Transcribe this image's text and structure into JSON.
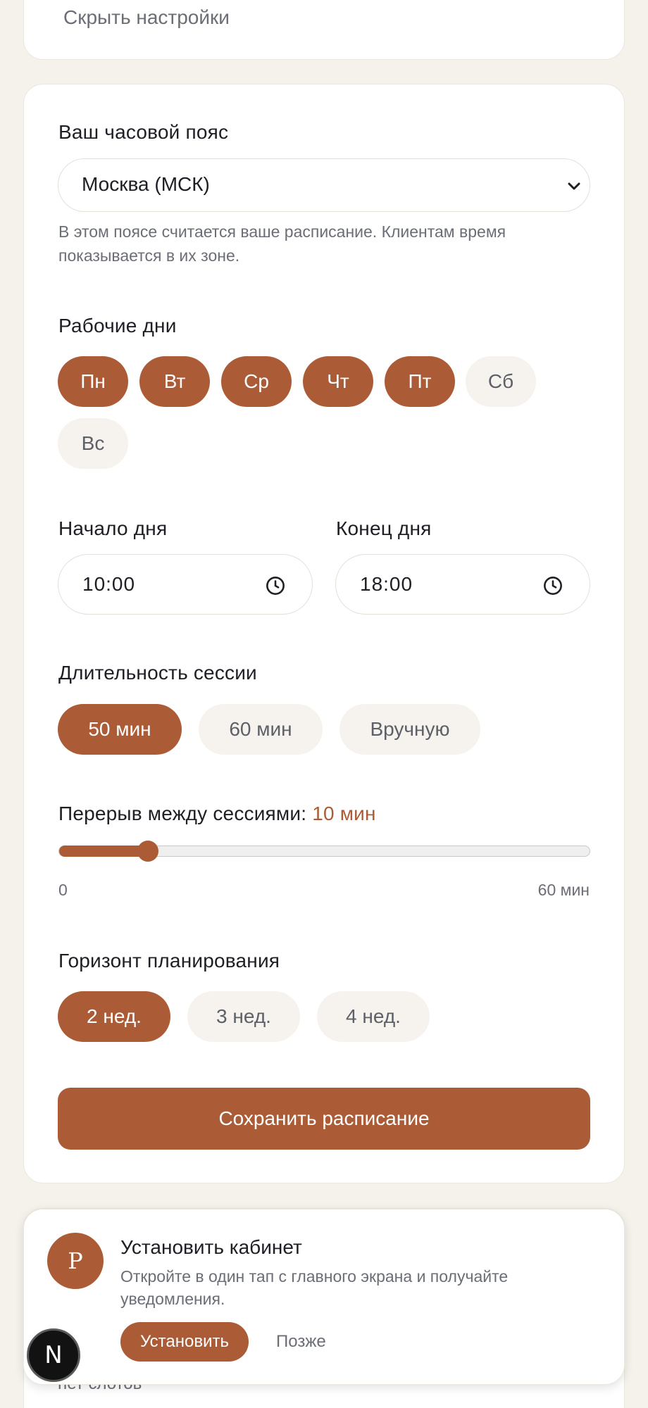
{
  "settings_header": {
    "hide_link": "Скрыть настройки"
  },
  "timezone": {
    "label": "Ваш часовой пояс",
    "value": "Москва (МСК)",
    "help": "В этом поясе считается ваше расписание. Клиентам время показывается в их зоне."
  },
  "workdays": {
    "label": "Рабочие дни",
    "days": [
      {
        "label": "Пн",
        "selected": true
      },
      {
        "label": "Вт",
        "selected": true
      },
      {
        "label": "Ср",
        "selected": true
      },
      {
        "label": "Чт",
        "selected": true
      },
      {
        "label": "Пт",
        "selected": true
      },
      {
        "label": "Сб",
        "selected": false
      },
      {
        "label": "Вс",
        "selected": false
      }
    ]
  },
  "hours": {
    "start_label": "Начало дня",
    "start_value": "10:00",
    "end_label": "Конец дня",
    "end_value": "18:00"
  },
  "session": {
    "label": "Длительность сессии",
    "options": [
      {
        "label": "50 мин",
        "selected": true
      },
      {
        "label": "60 мин",
        "selected": false
      },
      {
        "label": "Вручную",
        "selected": false
      }
    ]
  },
  "break": {
    "label": "Перерыв между сессиями:",
    "value_text": "10 мин",
    "value": 10,
    "min": 0,
    "max": 60,
    "min_label": "0",
    "max_label": "60 мин"
  },
  "horizon": {
    "label": "Горизонт планирования",
    "options": [
      {
        "label": "2 нед.",
        "selected": true
      },
      {
        "label": "3 нед.",
        "selected": false
      },
      {
        "label": "4 нед.",
        "selected": false
      }
    ]
  },
  "save_button": "Сохранить расписание",
  "next_card_peek": "нет слотов",
  "install_prompt": {
    "logo_letter": "P",
    "title": "Установить кабинет",
    "description": "Откройте в один тап с главного экрана и получайте уведомления.",
    "install_label": "Установить",
    "later_label": "Позже"
  },
  "dev_badge": "N",
  "colors": {
    "accent": "#ab5c37",
    "background": "#f5f2ec",
    "chip_off": "#f6f3ee"
  }
}
